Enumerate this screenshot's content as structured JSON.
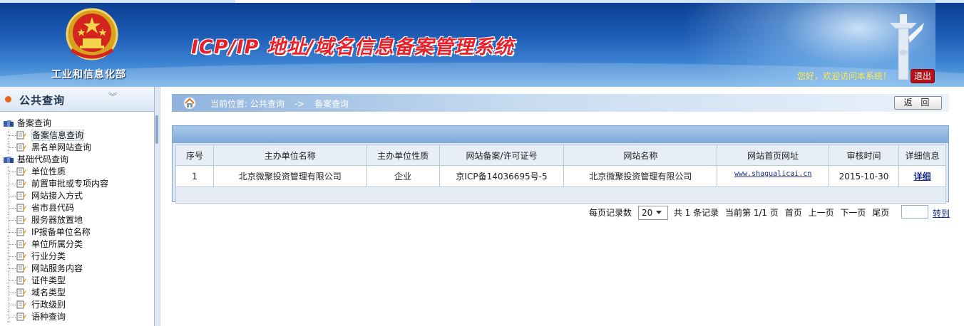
{
  "header": {
    "ministry": "工业和信息化部",
    "system_title": "ICP/IP 地址/域名信息备案管理系统",
    "welcome": "您好，欢迎访问本系统！",
    "logout": "退出"
  },
  "sidebar": {
    "title": "公共查询",
    "categories": [
      {
        "label": "备案查询",
        "items": [
          "备案信息查询",
          "黑名单网站查询"
        ]
      },
      {
        "label": "基础代码查询",
        "items": [
          "单位性质",
          "前置审批或专项内容",
          "网站接入方式",
          "省市县代码",
          "服务器放置地",
          "IP报备单位名称",
          "单位所属分类",
          "行业分类",
          "网站服务内容",
          "证件类型",
          "域名类型",
          "行政级别",
          "语种查询"
        ]
      }
    ]
  },
  "breadcrumb": {
    "prefix": "当前位置:",
    "level1": "公共查询",
    "separator": "->",
    "level2": "备案查询",
    "back_button": "返  回"
  },
  "table": {
    "headers": [
      "序号",
      "主办单位名称",
      "主办单位性质",
      "网站备案/许可证号",
      "网站名称",
      "网站首页网址",
      "审核时间",
      "详细信息"
    ],
    "rows": [
      {
        "index": "1",
        "org_name": "北京微聚投资管理有限公司",
        "org_type": "企业",
        "license": "京ICP备14036695号-5",
        "site_name": "北京微聚投资管理有限公司",
        "url": "www.shagualicai.cn",
        "audit_time": "2015-10-30",
        "detail": "详细"
      }
    ]
  },
  "pager": {
    "per_page_label": "每页记录数",
    "per_page_value": "20",
    "total": "共 1 条记录",
    "current": "当前第 1/1 页",
    "first": "首页",
    "prev": "上一页",
    "next": "下一页",
    "last": "尾页",
    "goto": "转到"
  },
  "colors": {
    "header_blue": "#1c5bb4",
    "title_red": "#e8202a",
    "welcome_yellow": "#ffe94a",
    "link_blue": "#1a2c8c"
  }
}
